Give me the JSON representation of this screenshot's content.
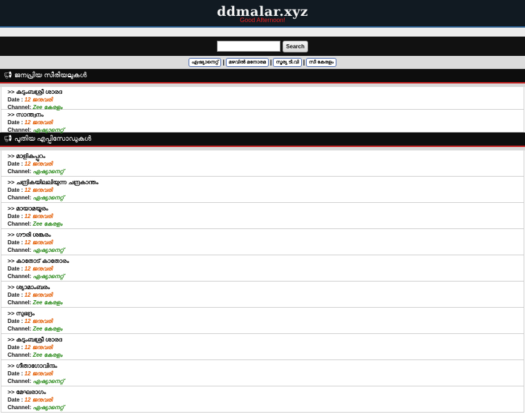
{
  "site": {
    "logo": "ddmalar.xyz",
    "greeting": "Good Afternoon!"
  },
  "search": {
    "placeholder": "",
    "button": "Search"
  },
  "channels": [
    "ഏഷ്യാനെറ്റ്",
    "മഴവിൽ മനോരമ",
    "സൂര്യ ടി.വി",
    "സീ കേരളം"
  ],
  "popular": {
    "heading": "ജനപ്രിയ സീരിയലുകൾ",
    "items": [
      {
        "title": ">> കുടുംബശ്രീ ശാരദ",
        "date_label": "Date :",
        "date": "12 ജനുവരി",
        "channel_label": "Channel:",
        "channel": "Zee കേരളം"
      },
      {
        "title": ">> സാന്ത്വനം",
        "date_label": "Date :",
        "date": "12 ജനുവരി",
        "channel_label": "Channel:",
        "channel": "ഏഷ്യാനെറ്റ്"
      }
    ]
  },
  "latest": {
    "heading": "പുതിയ എപ്പിസോഡുകൾ",
    "items": [
      {
        "title": ">> മാളികപ്പുറം",
        "date_label": "Date :",
        "date": "12 ജനുവരി",
        "channel_label": "Channel:",
        "channel": "ഏഷ്യാനെറ്റ്"
      },
      {
        "title": ">> ചന്ദ്രികയിലലിയുന്ന ചന്ദ്രകാന്തം",
        "date_label": "Date :",
        "date": "12 ജനുവരി",
        "channel_label": "Channel:",
        "channel": "ഏഷ്യാനെറ്റ്"
      },
      {
        "title": ">> മായാമയൂരം",
        "date_label": "Date :",
        "date": "12 ജനുവരി",
        "channel_label": "Channel:",
        "channel": "Zee കേരളം"
      },
      {
        "title": ">> ഗൗരി ശങ്കരം",
        "date_label": "Date :",
        "date": "12 ജനുവരി",
        "channel_label": "Channel:",
        "channel": "ഏഷ്യാനെറ്റ്"
      },
      {
        "title": ">> കാതോട് കാതോരം",
        "date_label": "Date :",
        "date": "12 ജനുവരി",
        "channel_label": "Channel:",
        "channel": "ഏഷ്യാനെറ്റ്"
      },
      {
        "title": ">> ശ്യാമാംബരം",
        "date_label": "Date :",
        "date": "12 ജനുവരി",
        "channel_label": "Channel:",
        "channel": "Zee കേരളം"
      },
      {
        "title": ">> സുഭദ്രം",
        "date_label": "Date :",
        "date": "12 ജനുവരി",
        "channel_label": "Channel:",
        "channel": "Zee കേരളം"
      },
      {
        "title": ">> കുടുംബശ്രീ ശാരദ",
        "date_label": "Date :",
        "date": "12 ജനുവരി",
        "channel_label": "Channel:",
        "channel": "Zee കേരളം"
      },
      {
        "title": ">> ഗീതാഗോവിന്ദം",
        "date_label": "Date :",
        "date": "12 ജനുവരി",
        "channel_label": "Channel:",
        "channel": "ഏഷ്യാനെറ്റ്"
      },
      {
        "title": ">> മേഘരാഗം",
        "date_label": "Date :",
        "date": "12 ജനുവരി",
        "channel_label": "Channel:",
        "channel": "ഏഷ്യാനെറ്റ്"
      }
    ]
  }
}
